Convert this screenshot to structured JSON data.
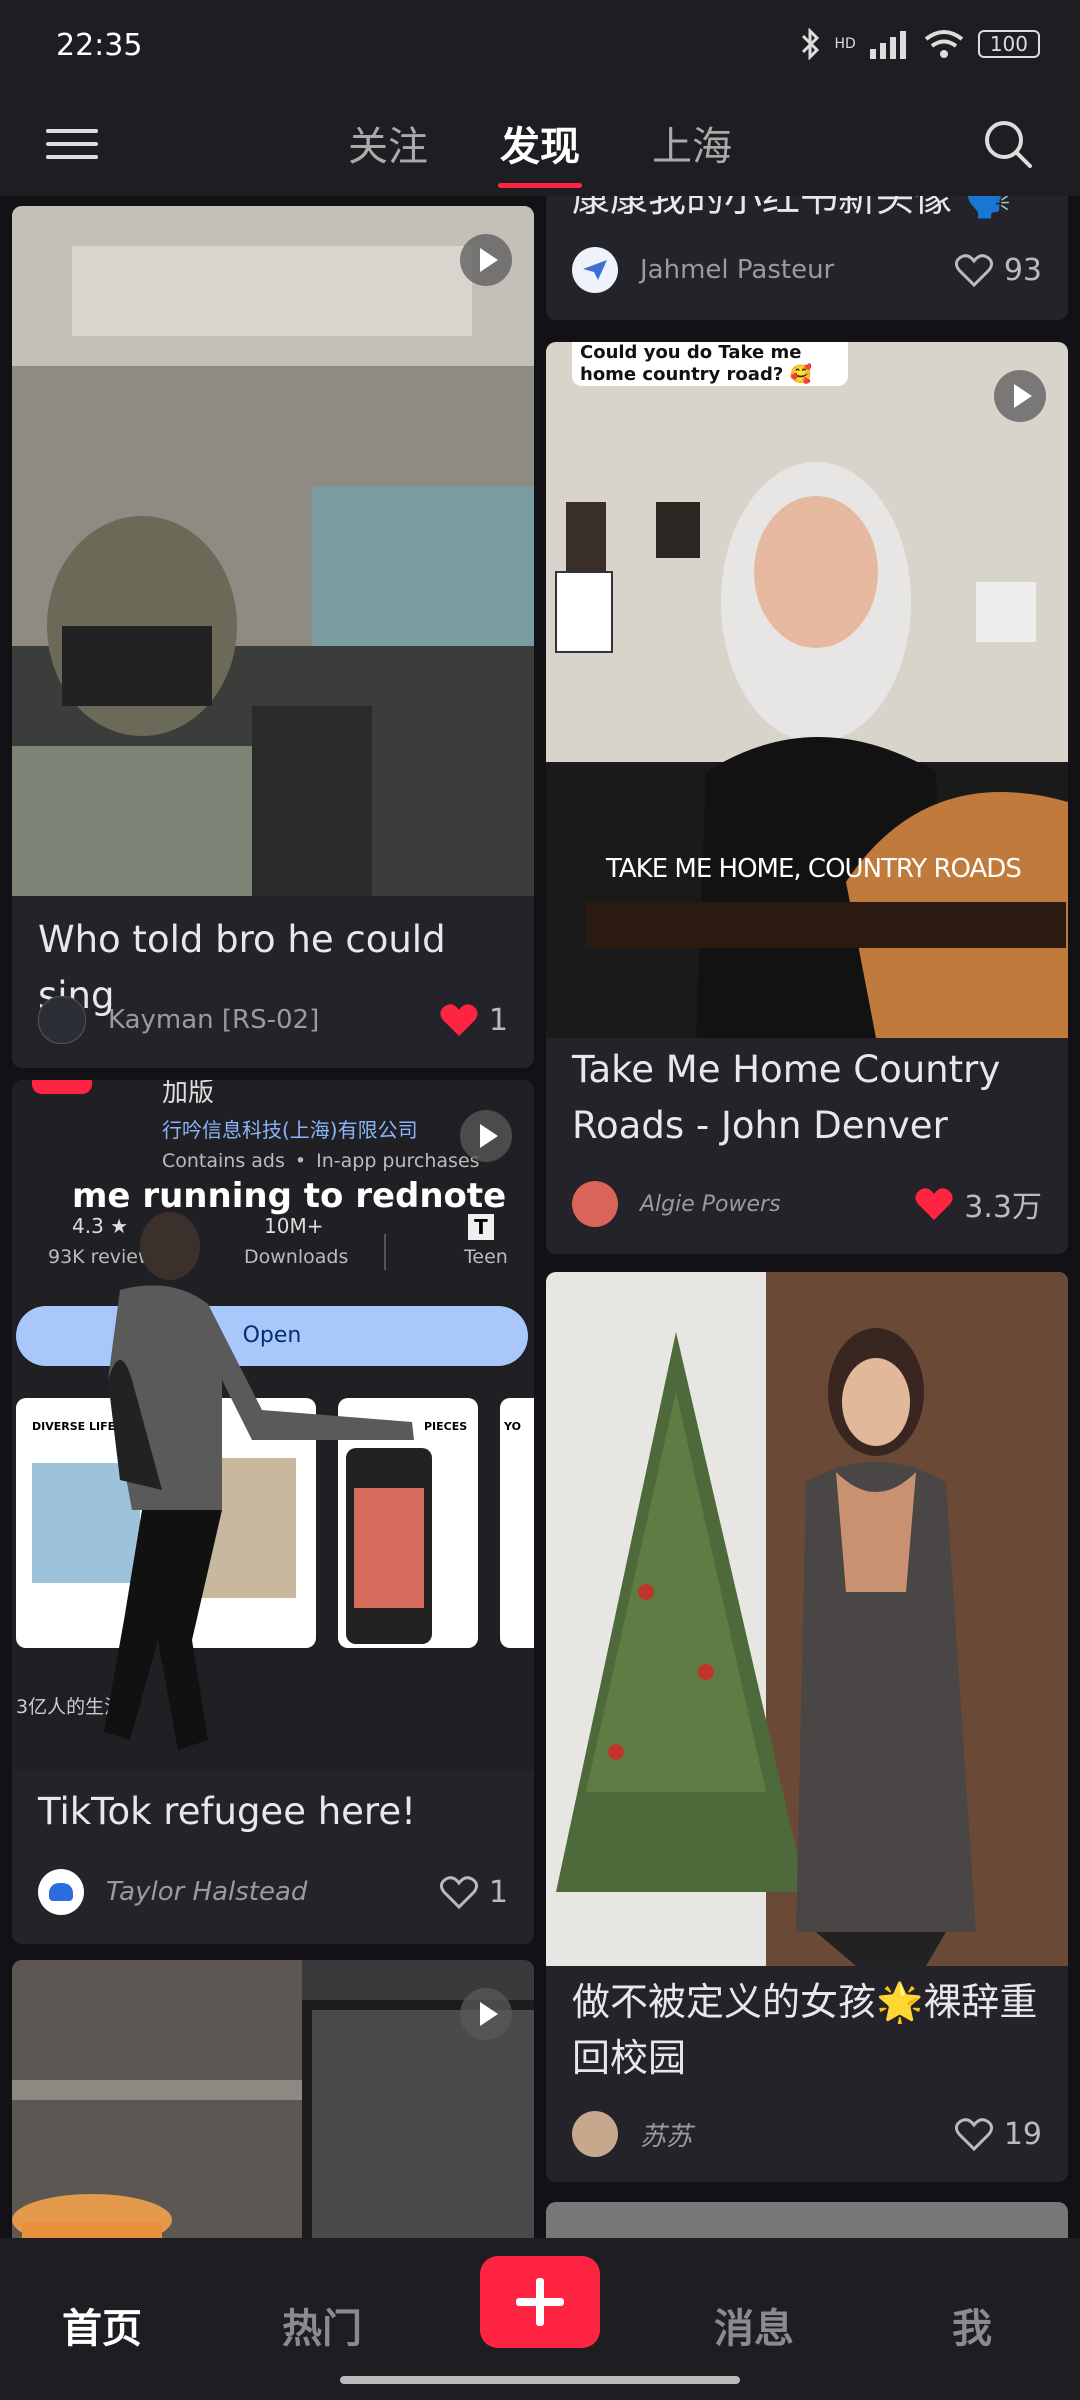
{
  "status_bar": {
    "time": "22:35",
    "network_label": "HD",
    "battery": "100"
  },
  "top_nav": {
    "tabs": [
      "关注",
      "发现",
      "上海"
    ],
    "active_tab": "发现"
  },
  "feed": {
    "left_column": [
      {
        "title": "Who told bro he could sing",
        "author": "Kayman [RS-02]",
        "likes": "1",
        "liked": true,
        "video": true
      },
      {
        "title": "TikTok refugee here!",
        "author": "Taylor Halstead",
        "likes": "1",
        "liked": false,
        "video": true,
        "overlay": {
          "partial_title": "加版",
          "developer": "行吟信息科技(上海)有限公司",
          "contains": "Contains ads",
          "purchases": "In-app purchases",
          "caption": "me running to rednote",
          "rating": "4.3 ★",
          "reviews": "93K reviews",
          "downloads": "10M+",
          "downloads_label": "Downloads",
          "teen": "Teen",
          "open_button": "Open",
          "screenshots": [
            "DIVERSE LIFE",
            "",
            "PIECES",
            "YO"
          ],
          "bottom_text": "3亿人的生活扌"
        }
      },
      {
        "title": "",
        "author": "",
        "likes": "",
        "liked": false,
        "video": true
      }
    ],
    "right_column": [
      {
        "title": "康康我的小红书新头像 🗣️",
        "author": "Jahmel Pasteur",
        "likes": "93",
        "liked": false
      },
      {
        "title": "Take Me Home Country Roads - John Denver",
        "author": "Algie Powers",
        "likes": "3.3万",
        "liked": true,
        "video": true,
        "overlay": {
          "bubble": "Could you do Take me home country road? 🥰",
          "caption": "TAKE ME HOME, COUNTRY ROADS"
        }
      },
      {
        "title": "做不被定义的女孩🌟裸辞重回校园",
        "author": "苏苏",
        "likes": "19",
        "liked": false
      }
    ]
  },
  "bottom_nav": {
    "items": [
      "首页",
      "热门",
      "消息",
      "我"
    ],
    "active": "首页"
  },
  "colors": {
    "accent": "#ff2442",
    "background": "#121216",
    "card": "#232329"
  }
}
